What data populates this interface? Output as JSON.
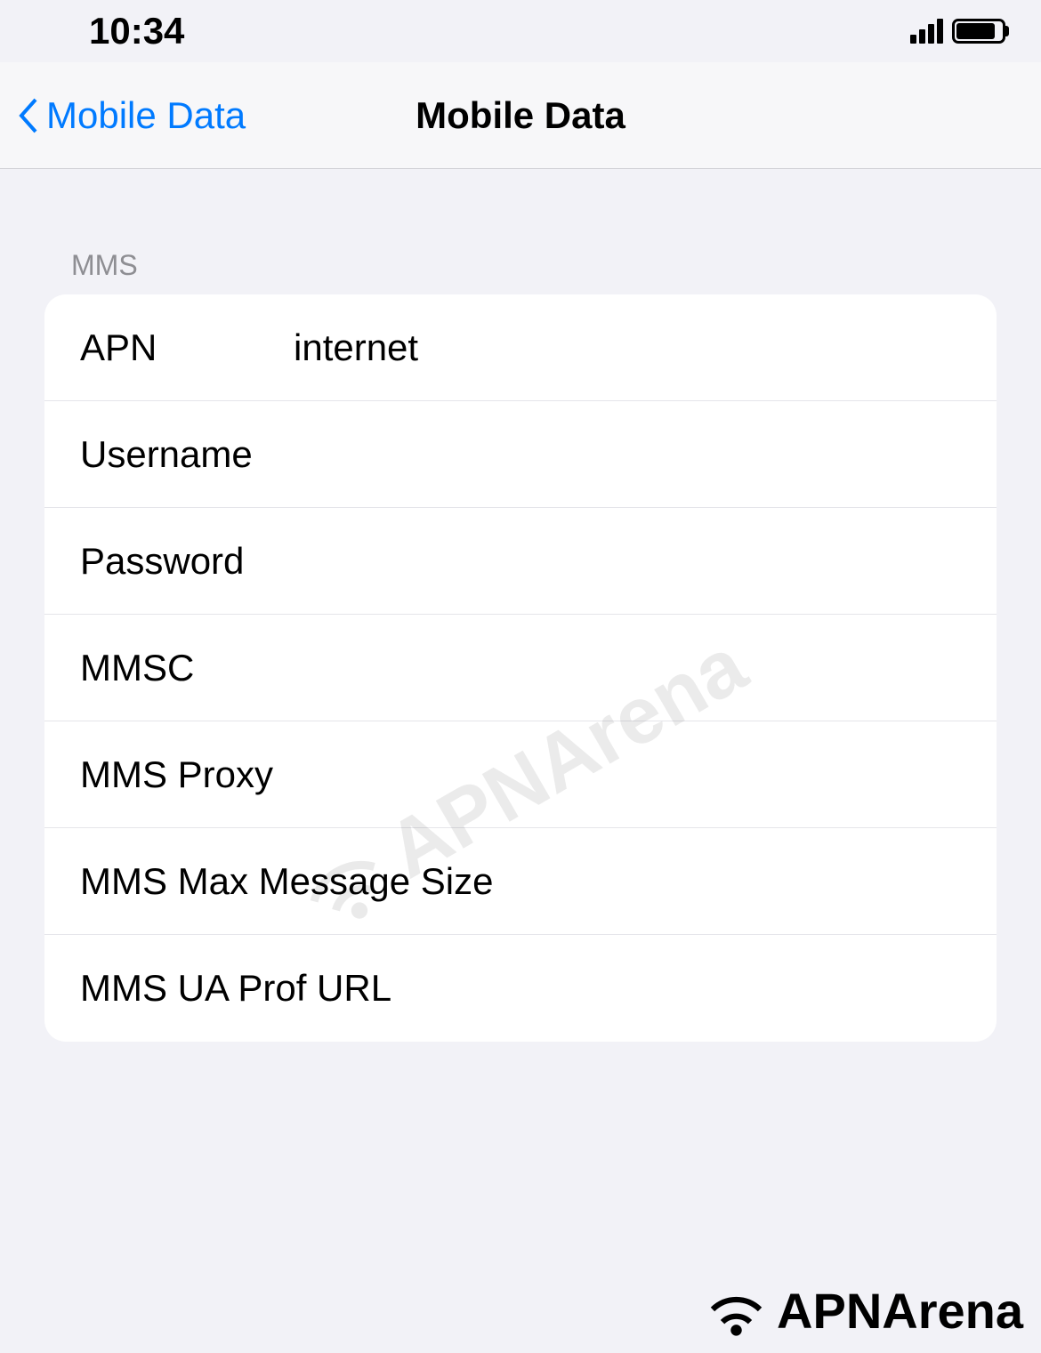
{
  "status_bar": {
    "time": "10:34"
  },
  "nav": {
    "back_label": "Mobile Data",
    "title": "Mobile Data"
  },
  "section": {
    "header": "MMS",
    "rows": [
      {
        "label": "APN",
        "value": "internet"
      },
      {
        "label": "Username",
        "value": ""
      },
      {
        "label": "Password",
        "value": ""
      },
      {
        "label": "MMSC",
        "value": ""
      },
      {
        "label": "MMS Proxy",
        "value": ""
      },
      {
        "label": "MMS Max Message Size",
        "value": ""
      },
      {
        "label": "MMS UA Prof URL",
        "value": ""
      }
    ]
  },
  "branding": {
    "name": "APNArena"
  }
}
